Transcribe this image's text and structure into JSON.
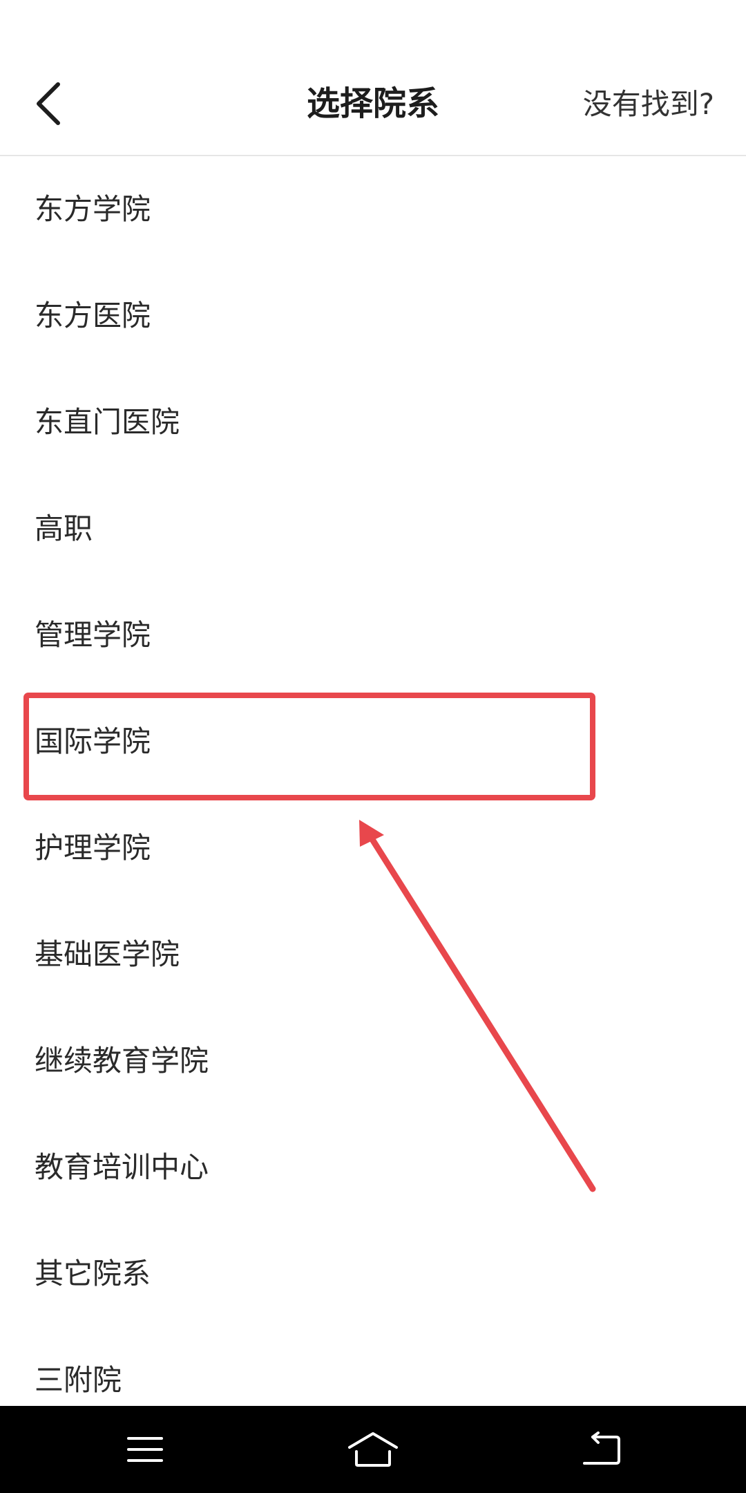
{
  "header": {
    "title": "选择院系",
    "not_found_label": "没有找到?"
  },
  "list": {
    "items": [
      {
        "label": "东方学院"
      },
      {
        "label": "东方医院"
      },
      {
        "label": "东直门医院"
      },
      {
        "label": "高职"
      },
      {
        "label": "管理学院"
      },
      {
        "label": "国际学院"
      },
      {
        "label": "护理学院"
      },
      {
        "label": "基础医学院"
      },
      {
        "label": "继续教育学院"
      },
      {
        "label": "教育培训中心"
      },
      {
        "label": "其它院系"
      },
      {
        "label": "三附院"
      }
    ],
    "highlighted_item": "国际学院"
  },
  "annotation": {
    "color": "#e8474c"
  },
  "icons": {
    "back": "chevron-left-icon",
    "menu": "menu-icon",
    "home": "home-icon",
    "return": "return-icon"
  },
  "colors": {
    "background": "#ffffff",
    "navbar": "#000000",
    "annotation": "#e8474c"
  }
}
